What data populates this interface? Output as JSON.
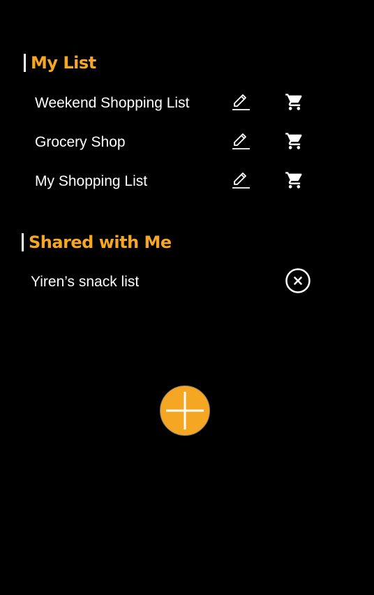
{
  "colors": {
    "background": "#000000",
    "accent": "#f5a623",
    "text": "#ffffff"
  },
  "my_list": {
    "title": "My List",
    "items": [
      {
        "label": "Weekend Shopping List",
        "edit_icon": "pencil-icon",
        "cart_icon": "cart-icon"
      },
      {
        "label": "Grocery Shop",
        "edit_icon": "pencil-icon",
        "cart_icon": "cart-icon"
      },
      {
        "label": "My Shopping List",
        "edit_icon": "pencil-icon",
        "cart_icon": "cart-icon"
      }
    ]
  },
  "shared": {
    "title": "Shared with Me",
    "items": [
      {
        "label": "Yiren’s snack list",
        "remove_icon": "close-circle-icon"
      }
    ]
  },
  "fab": {
    "icon": "plus-icon"
  }
}
